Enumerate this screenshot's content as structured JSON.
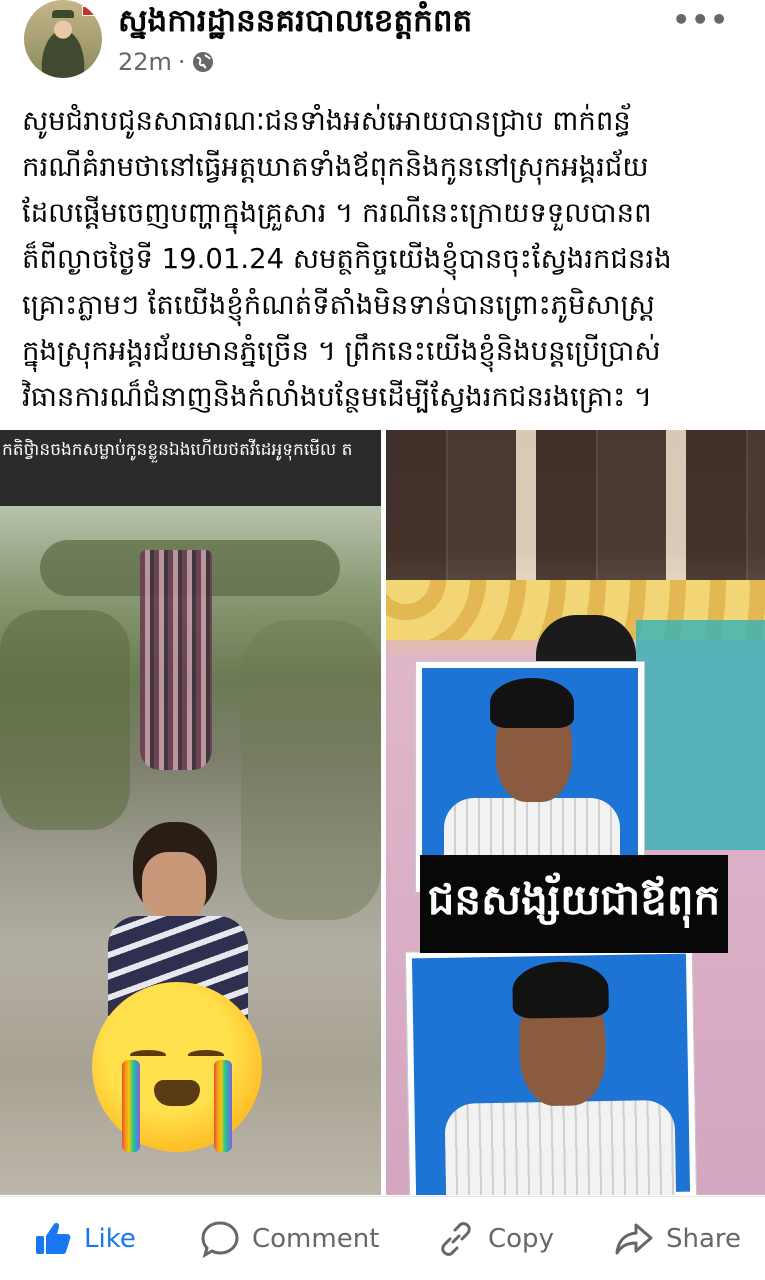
{
  "post": {
    "page_name": "ស្នងការដ្ឋាននគរបាលខេត្តកំពត",
    "time": "22m",
    "separator": "·",
    "audience_icon": "globe-icon",
    "more_icon": "more-options-icon",
    "more_label": "•••",
    "text_lines": [
      "សូមជំរាបជូនសាធារណៈជនទាំងអស់អោយបានជ្រាប ពាក់ពន្ធ័",
      "ករណីគំរាមថានៅធ្វើអត្តឃាតទាំងឪពុកនិងកូននៅស្រុកអង្គរជ័យ",
      "ដែលផ្ដើមចេញបញ្ហាក្នុងគ្រួសារ ។ ករណីនេះក្រោយទទួលបានព",
      "ត៏ពីល្ងាចថ្ងៃទី 19.01.24 សមត្ថកិច្ចយើងខ្ញុំបានចុះស្វែងរកជនរង",
      "គ្រោះភ្លាមៗ តែយើងខ្ញុំកំណត់ទីតាំងមិនទាន់បានព្រោះភូមិសាស្រ្ត",
      "ក្នុងស្រុកអង្គរជ័យមានភ្នំច្រើន ។ ព្រឹកនេះយើងខ្ញុំនិងបន្តប្រើប្រាស់",
      "វិធានការណ៏ជំនាញនិងកំលាំងបន្ថែមដើម្បីស្វែងរកជនរងគ្រោះ ។"
    ]
  },
  "media": {
    "left_caption": "កតិថ្វិានចងកសម្លាប់កូនខ្លួនឯងហើយថតវីដេអូទុកមើល ត",
    "right_label": "ជនសង្ស័យជាឪពុក"
  },
  "actions": {
    "like": "Like",
    "comment": "Comment",
    "copy": "Copy",
    "share": "Share"
  },
  "colors": {
    "like_blue": "#1877f2",
    "muted_text": "#65676b",
    "label_bg": "#080808"
  }
}
